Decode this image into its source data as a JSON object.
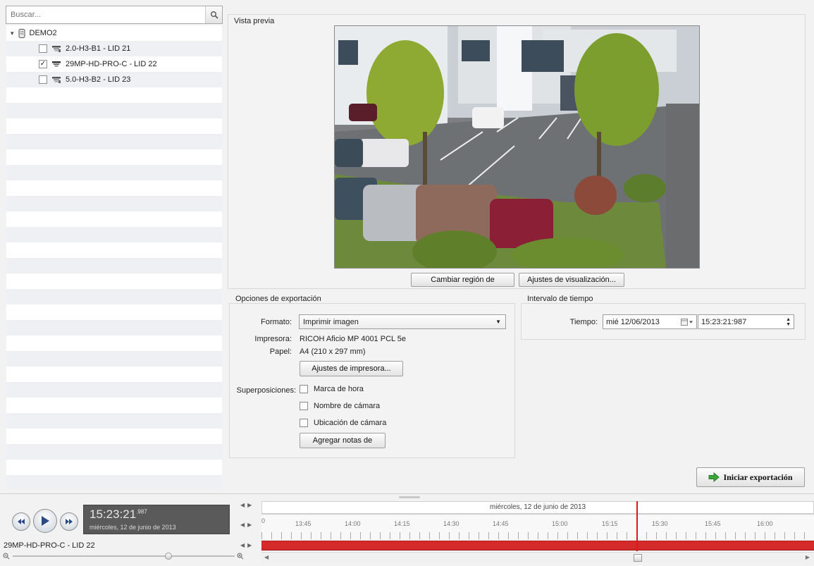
{
  "search": {
    "placeholder": "Buscar..."
  },
  "tree": {
    "root": "DEMO2",
    "cameras": [
      {
        "label": "2.0-H3-B1 - LID 21",
        "checked": false
      },
      {
        "label": "29MP-HD-PRO-C - LID 22",
        "checked": true
      },
      {
        "label": "5.0-H3-B2 - LID 23",
        "checked": false
      }
    ]
  },
  "preview": {
    "title": "Vista previa",
    "change_region_button": "Cambiar región de",
    "display_settings_button": "Ajustes de visualización..."
  },
  "export_options": {
    "title": "Opciones de exportación",
    "format_label": "Formato:",
    "format_value": "Imprimir imagen",
    "printer_label": "Impresora:",
    "printer_value": "RICOH Aficio MP 4001 PCL 5e",
    "paper_label": "Papel:",
    "paper_value": "A4 (210 x 297 mm)",
    "printer_settings_button": "Ajustes de impresora...",
    "overlays_label": "Superposiciones:",
    "overlays": [
      {
        "label": "Marca de hora",
        "checked": false
      },
      {
        "label": "Nombre de cámara",
        "checked": false
      },
      {
        "label": "Ubicación de cámara",
        "checked": false
      }
    ],
    "add_notes_button": "Agregar notas de"
  },
  "time_interval": {
    "title": "Intervalo de tiempo",
    "time_label": "Tiempo:",
    "date_value": "mié 12/06/2013",
    "time_value": "15:23:21:987"
  },
  "start_export_button": "Iniciar exportación",
  "playback": {
    "time": "15:23:21",
    "ms": ".987",
    "date": "miércoles, 12 de junio de 2013",
    "camera_label": "29MP-HD-PRO-C - LID 22"
  },
  "timeline": {
    "date_header": "miércoles, 12 de junio de 2013",
    "zero_label": "0",
    "ticks": [
      "13:45",
      "14:00",
      "14:15",
      "14:30",
      "14:45",
      "15:00",
      "15:15",
      "15:30",
      "15:45",
      "16:00"
    ]
  },
  "colors": {
    "accent_red": "#d42a2a",
    "cursor_red": "#e0161f",
    "export_green": "#3aa63a"
  }
}
